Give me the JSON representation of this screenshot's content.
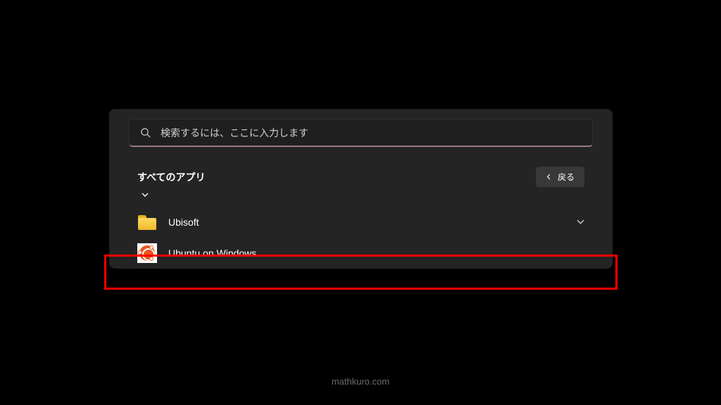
{
  "search": {
    "placeholder": "検索するには、ここに入力します"
  },
  "header": {
    "title": "すべてのアプリ",
    "back_label": "戻る"
  },
  "items": [
    {
      "label": "Ubisoft",
      "type": "folder",
      "expandable": true
    },
    {
      "label": "Ubuntu on Windows",
      "type": "app",
      "expandable": false
    }
  ],
  "watermark": "mathkuro.com"
}
